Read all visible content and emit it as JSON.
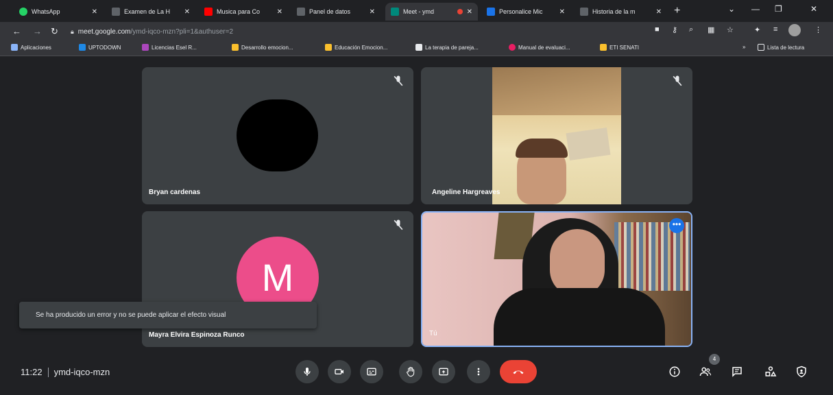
{
  "browser": {
    "tabs": [
      {
        "label": "WhatsApp",
        "color": "#25d366"
      },
      {
        "label": "Examen de La H",
        "color": "#5f6368"
      },
      {
        "label": "Musica para Co",
        "color": "#ff0000"
      },
      {
        "label": "Panel de datos",
        "color": "#5f6368"
      },
      {
        "label": "Meet - ymd",
        "color": "#00897b"
      },
      {
        "label": "Personalice Mic",
        "color": "#1a73e8"
      },
      {
        "label": "Historia de la m",
        "color": "#5f6368"
      }
    ],
    "url_host": "meet.google.com",
    "url_path": "/ymd-iqco-mzn?pli=1&authuser=2",
    "bookmarks": [
      {
        "label": "Aplicaciones",
        "color": "#8ab4f8"
      },
      {
        "label": "UPTODOWN",
        "color": "#1e88e5"
      },
      {
        "label": "Licencias Esel R...",
        "color": "#ab47bc"
      },
      {
        "label": "Desarrollo emocion...",
        "color": "#fbc02d"
      },
      {
        "label": "Educación Emocion...",
        "color": "#fbc02d"
      },
      {
        "label": "La terapia de pareja...",
        "color": "#e8eaed"
      },
      {
        "label": "Manual de evaluaci...",
        "color": "#e91e63"
      },
      {
        "label": "ETI SENATI",
        "color": "#fbc02d"
      }
    ],
    "reading_list": "Lista de lectura"
  },
  "participants": [
    {
      "name": "Bryan cardenas",
      "avatar": "none",
      "avatar_color": "#000000"
    },
    {
      "name": "Angeline Hargreaves",
      "avatar": "video"
    },
    {
      "name": "Mayra Elvira Espinoza Runco",
      "avatar_letter": "M",
      "avatar_color": "#ec4d8a"
    },
    {
      "name": "Tú",
      "avatar": "video"
    }
  ],
  "toast": {
    "message": "Se ha producido un error y no se puede aplicar el efecto visual"
  },
  "footer": {
    "time": "11:22",
    "meeting_code": "ymd-iqco-mzn",
    "participants_count": "4"
  },
  "colors": {
    "accent": "#8ab4f8",
    "end_call": "#ea4335",
    "background": "#202124",
    "tile": "#3c4043"
  }
}
